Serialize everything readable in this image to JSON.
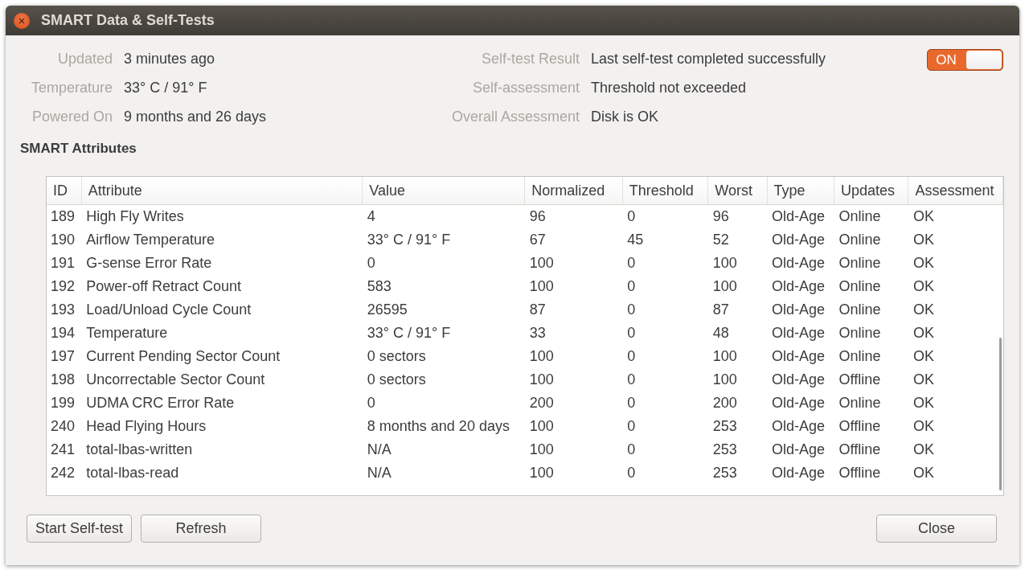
{
  "window": {
    "title": "SMART Data & Self-Tests"
  },
  "info_left": [
    {
      "label": "Updated",
      "value": "3 minutes ago"
    },
    {
      "label": "Temperature",
      "value": "33° C / 91° F"
    },
    {
      "label": "Powered On",
      "value": "9 months and 26 days"
    }
  ],
  "info_right": [
    {
      "label": "Self-test Result",
      "value": "Last self-test completed successfully"
    },
    {
      "label": "Self-assessment",
      "value": "Threshold not exceeded"
    },
    {
      "label": "Overall Assessment",
      "value": "Disk is OK"
    }
  ],
  "toggle": {
    "label": "ON",
    "on": true
  },
  "section_title": "SMART Attributes",
  "table": {
    "columns": [
      "ID",
      "Attribute",
      "Value",
      "Normalized",
      "Threshold",
      "Worst",
      "Type",
      "Updates",
      "Assessment"
    ],
    "rows": [
      [
        "189",
        "High Fly Writes",
        "4",
        "96",
        "0",
        "96",
        "Old-Age",
        "Online",
        "OK"
      ],
      [
        "190",
        "Airflow Temperature",
        "33° C / 91° F",
        "67",
        "45",
        "52",
        "Old-Age",
        "Online",
        "OK"
      ],
      [
        "191",
        "G-sense Error Rate",
        "0",
        "100",
        "0",
        "100",
        "Old-Age",
        "Online",
        "OK"
      ],
      [
        "192",
        "Power-off Retract Count",
        "583",
        "100",
        "0",
        "100",
        "Old-Age",
        "Online",
        "OK"
      ],
      [
        "193",
        "Load/Unload Cycle Count",
        "26595",
        "87",
        "0",
        "87",
        "Old-Age",
        "Online",
        "OK"
      ],
      [
        "194",
        "Temperature",
        "33° C / 91° F",
        "33",
        "0",
        "48",
        "Old-Age",
        "Online",
        "OK"
      ],
      [
        "197",
        "Current Pending Sector Count",
        "0 sectors",
        "100",
        "0",
        "100",
        "Old-Age",
        "Online",
        "OK"
      ],
      [
        "198",
        "Uncorrectable Sector Count",
        "0 sectors",
        "100",
        "0",
        "100",
        "Old-Age",
        "Offline",
        "OK"
      ],
      [
        "199",
        "UDMA CRC Error Rate",
        "0",
        "200",
        "0",
        "200",
        "Old-Age",
        "Online",
        "OK"
      ],
      [
        "240",
        "Head Flying Hours",
        "8 months and 20 days",
        "100",
        "0",
        "253",
        "Old-Age",
        "Offline",
        "OK"
      ],
      [
        "241",
        "total-lbas-written",
        "N/A",
        "100",
        "0",
        "253",
        "Old-Age",
        "Offline",
        "OK"
      ],
      [
        "242",
        "total-lbas-read",
        "N/A",
        "100",
        "0",
        "253",
        "Old-Age",
        "Offline",
        "OK"
      ]
    ]
  },
  "buttons_left": [
    "Start Self-test",
    "Refresh"
  ],
  "buttons_right": [
    "Close"
  ]
}
